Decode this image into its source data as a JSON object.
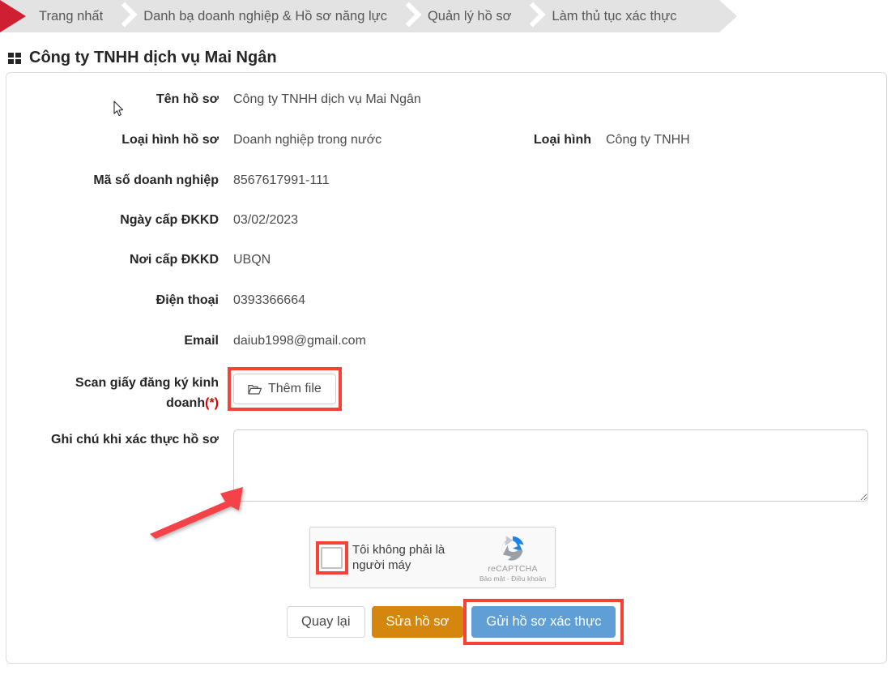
{
  "breadcrumb": {
    "items": [
      {
        "label": "Trang nhất"
      },
      {
        "label": "Danh bạ doanh nghiệp & Hồ sơ năng lực"
      },
      {
        "label": "Quản lý hồ sơ"
      },
      {
        "label": "Làm thủ tục xác thực"
      }
    ]
  },
  "page": {
    "title": "Công ty TNHH dịch vụ Mai Ngân",
    "title_icon": "grid-icon"
  },
  "form": {
    "fields": [
      {
        "label": "Tên hồ sơ",
        "value": "Công ty TNHH dịch vụ Mai Ngân"
      },
      {
        "label": "Loại hình hồ sơ",
        "value": "Doanh nghiệp trong nước"
      },
      {
        "label": "Mã số doanh nghiệp",
        "value": "8567617991-111"
      },
      {
        "label": "Ngày cấp ĐKKD",
        "value": "03/02/2023"
      },
      {
        "label": "Nơi cấp ĐKKD",
        "value": "UBQN"
      },
      {
        "label": "Điện thoại",
        "value": "0393366664"
      },
      {
        "label": "Email",
        "value": "daiub1998@gmail.com"
      }
    ],
    "secondary_field": {
      "label": "Loại hình",
      "value": "Công ty TNHH"
    },
    "scan": {
      "label": "Scan giấy đăng ký kinh doanh",
      "required_mark": "(*)",
      "button_label": "Thêm file",
      "button_icon": "folder-open-icon"
    },
    "note": {
      "label": "Ghi chú khi xác thực hồ sơ",
      "value": "",
      "placeholder": ""
    }
  },
  "recaptcha": {
    "checkbox_label": "Tôi không phải là người máy",
    "brand": "reCAPTCHA",
    "links": "Bảo mật - Điều khoản",
    "logo_icon": "recaptcha-logo-icon",
    "checked": false
  },
  "buttons": {
    "back": "Quay lại",
    "edit": "Sửa hồ sơ",
    "submit": "Gửi hồ sơ xác thực"
  },
  "colors": {
    "breadcrumb_bg": "#e3e3e3",
    "breadcrumb_marker": "#cf2033",
    "highlight": "#f44336",
    "edit_button": "#d4860e",
    "submit_button": "#5f9fd6",
    "required": "#e00000",
    "annotation_arrow": "#f4434a"
  },
  "annotations": {
    "arrow_target": "note-textarea",
    "highlight_targets": [
      "add-file-button",
      "recaptcha-checkbox",
      "submit-button"
    ]
  }
}
